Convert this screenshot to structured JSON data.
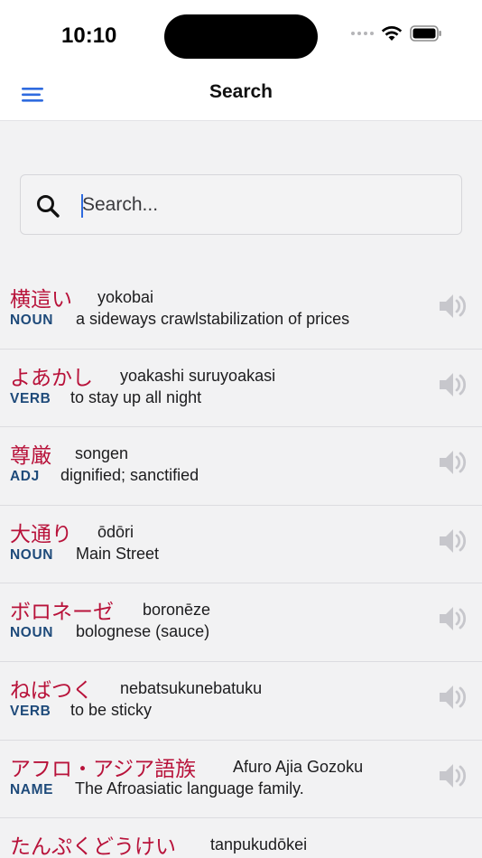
{
  "status": {
    "time": "10:10"
  },
  "nav": {
    "title": "Search"
  },
  "search": {
    "placeholder": "Search...",
    "value": ""
  },
  "results": [
    {
      "word": "横這い",
      "reading": "yokobai",
      "pos": "NOUN",
      "meaning": "a sideways crawlstabilization of prices"
    },
    {
      "word": "よあかし",
      "reading": "yoakashi suruyoakasi",
      "pos": "VERB",
      "meaning": "to stay up all night"
    },
    {
      "word": "尊厳",
      "reading": "songen",
      "pos": "ADJ",
      "meaning": "dignified; sanctified"
    },
    {
      "word": "大通り",
      "reading": "ōdōri",
      "pos": "NOUN",
      "meaning": "Main Street"
    },
    {
      "word": "ボロネーゼ",
      "reading": "boronēze",
      "pos": "NOUN",
      "meaning": "bolognese (sauce)"
    },
    {
      "word": "ねばつく",
      "reading": "nebatsukunebatuku",
      "pos": "VERB",
      "meaning": "to be sticky"
    },
    {
      "word": "アフロ・アジア語族",
      "reading": "Afuro Ajia Gozoku",
      "pos": "NAME",
      "meaning": "The Afroasiatic language family."
    },
    {
      "word": "たんぷくどうけい",
      "reading": "tanpukudōkei",
      "pos": "",
      "meaning": ""
    }
  ],
  "colors": {
    "word": "#b8123a",
    "pos": "#1e4a7a",
    "accent": "#2f6bdf",
    "speaker": "#c7c7cc"
  },
  "icons": {
    "menu": "hamburger-icon",
    "search": "search-icon",
    "speaker": "speaker-icon",
    "wifi": "wifi-icon",
    "battery": "battery-icon"
  }
}
